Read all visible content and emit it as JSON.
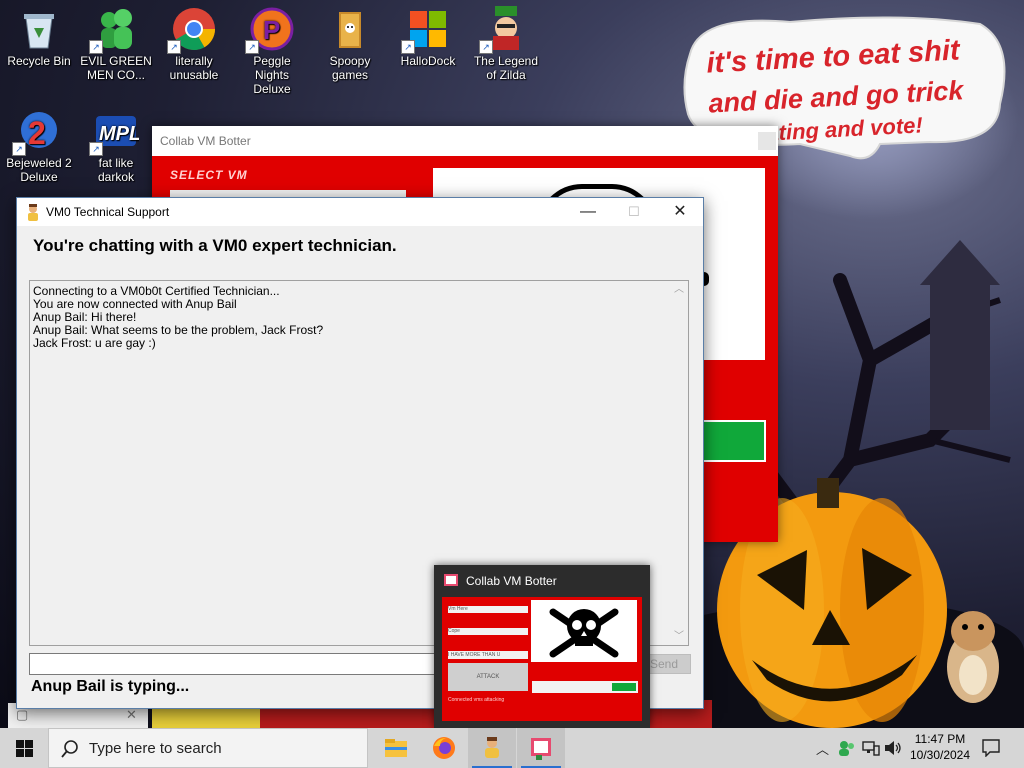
{
  "desktop": {
    "icons": [
      {
        "label": "Recycle Bin",
        "icon": "recycle-bin-icon"
      },
      {
        "label": "EVIL GREEN MEN CO...",
        "icon": "green-men-icon"
      },
      {
        "label": "literally unusable",
        "icon": "chrome-icon"
      },
      {
        "label": "Peggle Nights Deluxe",
        "icon": "peggle-icon"
      },
      {
        "label": "Spoopy games",
        "icon": "folder-icon"
      },
      {
        "label": "HalloDock",
        "icon": "windows-logo-icon"
      },
      {
        "label": "The Legend of Zilda",
        "icon": "zelda-icon"
      },
      {
        "label": "Bejeweled 2 Deluxe",
        "icon": "bejeweled-icon"
      },
      {
        "label": "fat like darkok",
        "icon": "mpl-icon"
      }
    ],
    "speech_bubble": {
      "line1": "it's time to eat shit",
      "line2": "and die and go trick",
      "line3": "or treating and vote!"
    }
  },
  "collab_window": {
    "title": "Collab VM Botter",
    "select_label": "SELECT VM",
    "accent": "#e00000",
    "progress_color": "#10a83a"
  },
  "chat_window": {
    "title": "VM0 Technical Support",
    "heading": "You're chatting with a VM0 expert technician.",
    "log": [
      "Connecting to a VM0b0t Certified Technician...",
      "You are now connected with Anup Bail",
      "Anup Bail: Hi there!",
      "Anup Bail: What seems to be the problem, Jack Frost?",
      "Jack Frost: u are gay :)"
    ],
    "message_value": "",
    "send_label": "Send",
    "typing_status": "Anup Bail is typing...",
    "controls": {
      "minimize": "—",
      "maximize": "☐",
      "close": "✕"
    }
  },
  "mini_preview": {
    "title": "Collab VM Botter",
    "field_1": "Vm Here",
    "field_2": "Cope",
    "field_3": "I HAVE MORE THAN U",
    "button": "ATTACK",
    "footer": "Connected vms attacking"
  },
  "taskbar": {
    "search_placeholder": "Type here to search",
    "time": "11:47 PM",
    "date": "10/30/2024",
    "apps": [
      "file-explorer-icon",
      "firefox-icon",
      "tech-support-icon",
      "collab-botter-icon"
    ]
  }
}
